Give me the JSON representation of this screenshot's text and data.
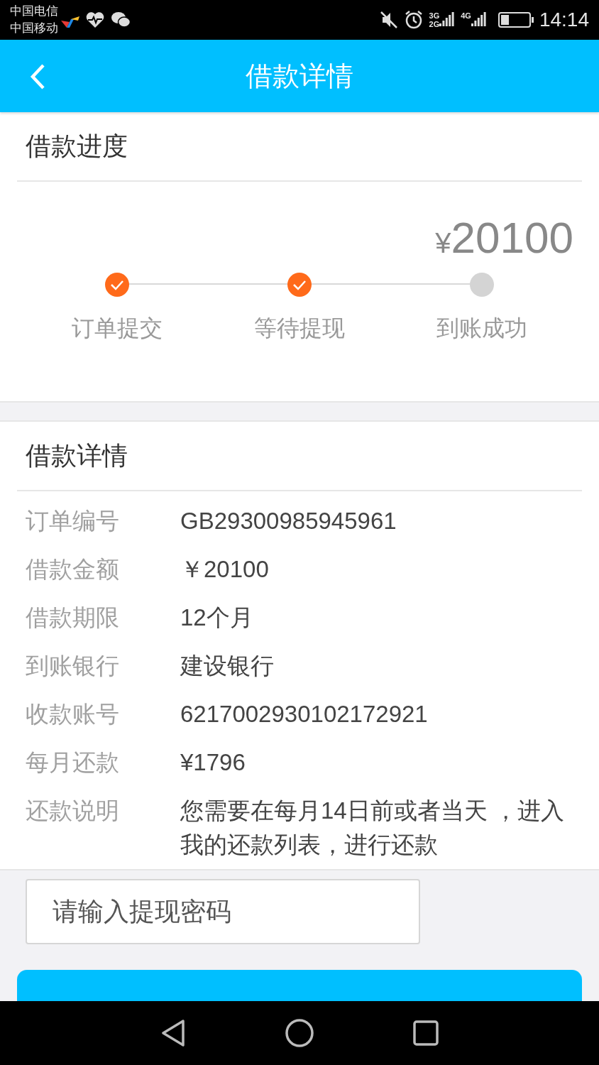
{
  "status_bar": {
    "carriers": [
      "中国电信",
      "中国移动"
    ],
    "network_labels": [
      "3G",
      "2G",
      "4G"
    ],
    "time": "14:14"
  },
  "header": {
    "title": "借款详情"
  },
  "progress": {
    "title": "借款进度",
    "amount": "20100",
    "currency": "¥",
    "steps": [
      {
        "label": "订单提交",
        "done": true
      },
      {
        "label": "等待提现",
        "done": true
      },
      {
        "label": "到账成功",
        "done": false
      }
    ]
  },
  "details": {
    "title": "借款详情",
    "rows": [
      {
        "label": "订单编号",
        "value": "GB29300985945961"
      },
      {
        "label": "借款金额",
        "value": "￥20100"
      },
      {
        "label": "借款期限",
        "value": "12个月"
      },
      {
        "label": "到账银行",
        "value": "建设银行"
      },
      {
        "label": "收款账号",
        "value": "6217002930102172921"
      },
      {
        "label": "每月还款",
        "value": "¥1796"
      },
      {
        "label": "还款说明",
        "value": "您需要在每月14日前或者当天 ，进入我的还款列表，进行还款"
      }
    ]
  },
  "password_field": {
    "placeholder": "请输入提现密码"
  }
}
